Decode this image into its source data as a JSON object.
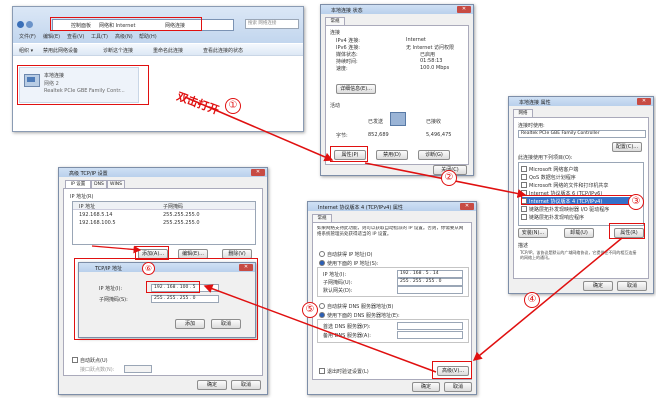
{
  "colors": {
    "annotation": "#e01010",
    "titlebar": "#c4d8f0",
    "close": "#c74b43"
  },
  "annotation": {
    "double_click_text": "双击打开",
    "steps": [
      "①",
      "②",
      "③",
      "④",
      "⑤",
      "⑥"
    ]
  },
  "explorer": {
    "address": [
      "控制面板",
      "网络和 Internet",
      "网络连接"
    ],
    "menu": [
      "文件(F)",
      "编辑(E)",
      "查看(V)",
      "工具(T)",
      "高级(N)",
      "帮助(H)"
    ],
    "toolbar": [
      "组织 ▾",
      "禁用此网络设备",
      "诊断这个连接",
      "重命名此连接",
      "查看此连接的状态"
    ],
    "search_placeholder": "搜索 网络连接",
    "adapter": {
      "name": "本地连接",
      "status": "网络 2",
      "device": "Realtek PCIe GBE Family Contr..."
    }
  },
  "status_dialog": {
    "title": "本地连接 状态",
    "tab": "常规",
    "section_connection": "连接",
    "rows": [
      {
        "label": "IPv4 连接:",
        "value": "Internet"
      },
      {
        "label": "IPv6 连接:",
        "value": "无 Internet 访问权限"
      },
      {
        "label": "媒体状态:",
        "value": "已启用"
      },
      {
        "label": "持续时间:",
        "value": "01:58:13"
      },
      {
        "label": "速度:",
        "value": "100.0 Mbps"
      }
    ],
    "details_btn": "详细信息(E)...",
    "section_activity": "活动",
    "sent": "已发送",
    "received": "已接收",
    "bytes_label": "字节:",
    "bytes_sent": "852,689",
    "bytes_received": "5,496,475",
    "buttons": [
      "属性(P)",
      "禁用(D)",
      "诊断(G)"
    ],
    "close_btn": "关闭(C)"
  },
  "props_dialog": {
    "title": "本地连接 属性",
    "tab": "网络",
    "connect_using": "连接时使用:",
    "adapter": "Realtek PCIe GBE Family Controller",
    "configure_btn": "配置(C)...",
    "items_label": "此连接使用下列项目(O):",
    "items": [
      "Microsoft 网络客户端",
      "QoS 数据包计划程序",
      "Microsoft 网络的文件和打印机共享",
      "Internet 协议版本 6 (TCP/IPv6)",
      "Internet 协议版本 4 (TCP/IPv4)",
      "链路层拓扑发现映射器 I/O 驱动程序",
      "链路层拓扑发现响应程序"
    ],
    "buttons": [
      "安装(N)...",
      "卸载(U)",
      "属性(R)"
    ],
    "desc_label": "描述",
    "desc": "TCP/IP。该协议是默认的广域网络协议，它提供在不同的相互连接的网络上的通讯。",
    "ok": "确定",
    "cancel": "取消"
  },
  "ipv4_dialog": {
    "title": "Internet 协议版本 4 (TCP/IPv4) 属性",
    "tab": "常规",
    "intro": "如果网络支持此功能，则可以获取自动指派的 IP 设置。否则，你需要从网络系统管理员处获得适当的 IP 设置。",
    "auto_ip": "自动获得 IP 地址(O)",
    "use_ip": "使用下面的 IP 地址(S):",
    "ip_label": "IP 地址(I):",
    "ip_value": "192 . 168 . 5 . 14",
    "mask_label": "子网掩码(U):",
    "mask_value": "255 . 255 . 255 . 0",
    "gw_label": "默认网关(D):",
    "auto_dns": "自动获得 DNS 服务器地址(B)",
    "use_dns": "使用下面的 DNS 服务器地址(E):",
    "dns1_label": "首选 DNS 服务器(P):",
    "dns2_label": "备用 DNS 服务器(A):",
    "validate": "退出时验证设置(L)",
    "advanced_btn": "高级(V)...",
    "ok": "确定",
    "cancel": "取消"
  },
  "advanced_dialog": {
    "title": "高级 TCP/IP 设置",
    "tabs": [
      "IP 设置",
      "DNS",
      "WINS"
    ],
    "ip_group": "IP 地址(R)",
    "col_ip": "IP 地址",
    "col_mask": "子网掩码",
    "rows": [
      {
        "ip": "192.168.5.14",
        "mask": "255.255.255.0"
      },
      {
        "ip": "192.168.100.5",
        "mask": "255.255.255.0"
      }
    ],
    "add_btn": "添加(A)...",
    "edit_btn": "编辑(E)...",
    "remove_btn": "删除(V)",
    "metric_label": "自动跃点(U)",
    "metric_field_label": "接口跃点数(N):",
    "ok": "确定",
    "cancel": "取消"
  },
  "addr_popup": {
    "title": "TCP/IP 地址",
    "ip_label": "IP 地址(I):",
    "ip_value": "192 . 168 . 100 . 5",
    "mask_label": "子网掩码(S):",
    "mask_value": "255 . 255 . 255 . 0",
    "add": "添加",
    "cancel": "取消"
  }
}
